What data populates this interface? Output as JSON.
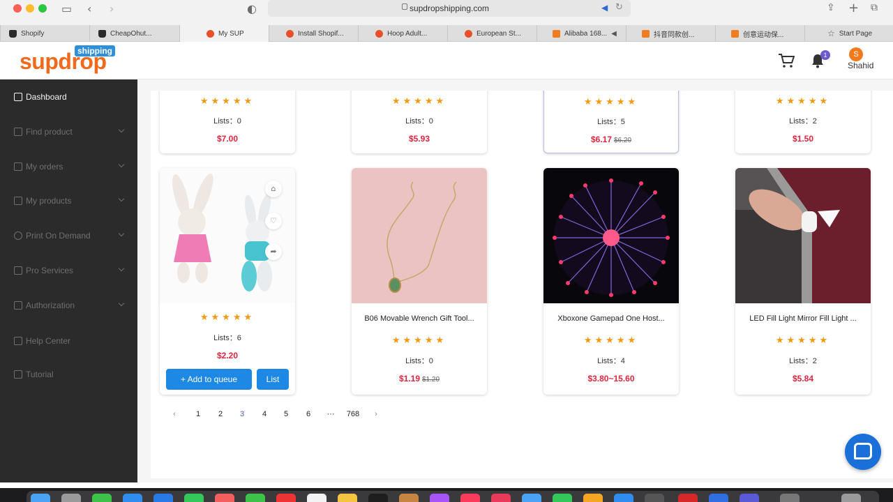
{
  "browser": {
    "url": "supdropshipping.com",
    "tabs": [
      {
        "label": "Shopify",
        "icon": "shopify-icon"
      },
      {
        "label": "CheapOhut...",
        "icon": "shopify-icon"
      },
      {
        "label": "My SUP",
        "icon": "supdrop-icon",
        "active": true
      },
      {
        "label": "Install Shopif...",
        "icon": "supdrop-icon"
      },
      {
        "label": "Hoop Adult...",
        "icon": "supdrop-icon"
      },
      {
        "label": "European St...",
        "icon": "supdrop-icon"
      },
      {
        "label": "Alibaba 168...",
        "icon": "alibaba-icon"
      },
      {
        "label": "抖音同款创...",
        "icon": "alibaba-icon"
      },
      {
        "label": "创意运动保...",
        "icon": "alibaba-icon"
      },
      {
        "label": "Start Page",
        "icon": "star-icon"
      }
    ]
  },
  "header": {
    "logo_text": "supdrop",
    "logo_tag": "shipping",
    "notification_count": "1",
    "user_initial": "S",
    "user_name": "Shahid"
  },
  "sidebar": {
    "items": [
      {
        "label": "Dashboard"
      },
      {
        "label": "Find product"
      },
      {
        "label": "My orders"
      },
      {
        "label": "My products"
      },
      {
        "label": "Print On Demand"
      },
      {
        "label": "Pro Services"
      },
      {
        "label": "Authorization"
      },
      {
        "label": "Help Center"
      },
      {
        "label": "Tutorial"
      }
    ]
  },
  "products_top": [
    {
      "stars": "★★★★★",
      "lists": "Lists：0",
      "price": "$7.00",
      "old_price": ""
    },
    {
      "stars": "★★★★★",
      "lists": "Lists：0",
      "price": "$5.93",
      "old_price": ""
    },
    {
      "stars": "★★★★★",
      "lists": "Lists：5",
      "price": "$6.17",
      "old_price": "$6.20"
    },
    {
      "stars": "★★★★★",
      "lists": "Lists：2",
      "price": "$1.50",
      "old_price": ""
    }
  ],
  "products_bottom": [
    {
      "title": "",
      "stars": "★★★★★",
      "lists": "Lists：6",
      "price": "$2.20",
      "old_price": "",
      "add_to_queue": "+ Add to queue",
      "list_button": "List"
    },
    {
      "title": "B06 Movable Wrench Gift Tool...",
      "stars": "★★★★★",
      "lists": "Lists：0",
      "price": "$1.19",
      "old_price": "$1.20"
    },
    {
      "title": "Xboxone Gamepad One Host...",
      "stars": "★★★★★",
      "lists": "Lists：4",
      "price": "$3.80~15.60",
      "old_price": ""
    },
    {
      "title": "LED Fill Light Mirror Fill Light ...",
      "stars": "★★★★★",
      "lists": "Lists：2",
      "price": "$5.84",
      "old_price": ""
    }
  ],
  "pagination": {
    "prev": "‹",
    "pages": [
      "1",
      "2",
      "3",
      "4",
      "5",
      "6"
    ],
    "current": "3",
    "ellipsis": "···",
    "last": "768",
    "next": "›"
  },
  "colors": {
    "brand_orange": "#ef6a1a",
    "price_red": "#e0243e",
    "star_orange": "#f39a12",
    "button_blue": "#1e88e5",
    "sidebar_bg": "#2b2b2b"
  }
}
